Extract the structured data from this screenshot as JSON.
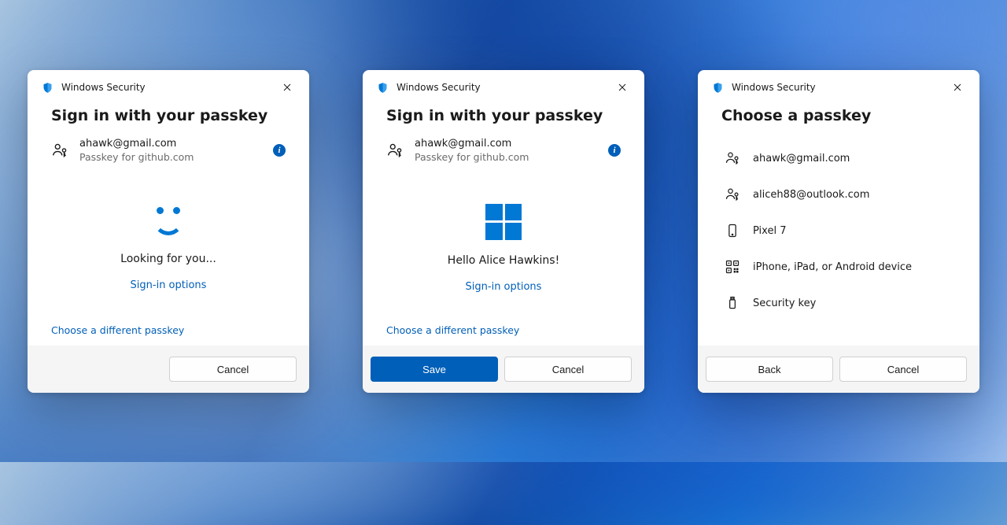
{
  "common": {
    "window_title": "Windows Security",
    "heading_signin": "Sign in with your passkey",
    "heading_choose": "Choose a passkey",
    "email": "ahawk@gmail.com",
    "passkey_for": "Passkey for github.com",
    "signin_options": "Sign-in options",
    "choose_different": "Choose a different passkey",
    "cancel": "Cancel",
    "back": "Back",
    "save": "Save"
  },
  "dialog1": {
    "status": "Looking for you..."
  },
  "dialog2": {
    "greeting": "Hello Alice Hawkins!"
  },
  "dialog3": {
    "items": [
      {
        "icon": "passkey",
        "label": "ahawk@gmail.com"
      },
      {
        "icon": "passkey",
        "label": "aliceh88@outlook.com"
      },
      {
        "icon": "phone",
        "label": "Pixel 7"
      },
      {
        "icon": "qr",
        "label": "iPhone, iPad, or Android device"
      },
      {
        "icon": "usb",
        "label": "Security key"
      }
    ]
  }
}
